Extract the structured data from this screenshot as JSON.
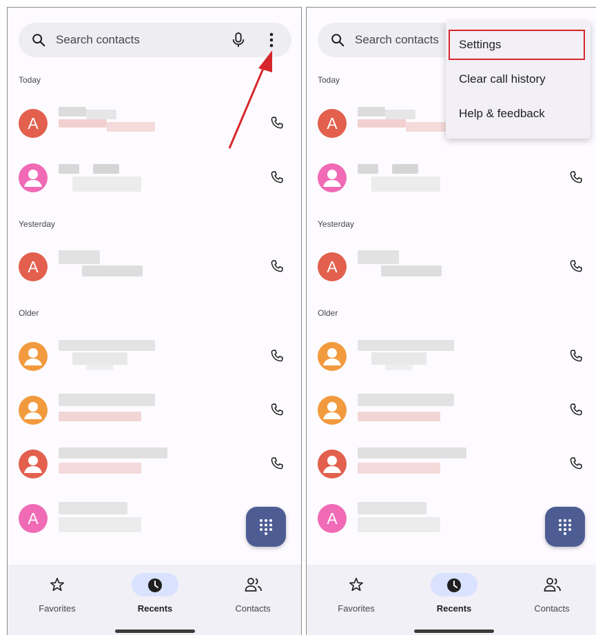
{
  "search": {
    "placeholder": "Search contacts"
  },
  "sections": {
    "today": "Today",
    "yesterday": "Yesterday",
    "older": "Older"
  },
  "contacts": [
    {
      "section": "today",
      "avatar_letter": "A",
      "avatar_type": "letter",
      "avatar_color": "#e2604d"
    },
    {
      "section": "today",
      "avatar_letter": "",
      "avatar_type": "person",
      "avatar_color": "#f06ab6"
    },
    {
      "section": "yesterday",
      "avatar_letter": "A",
      "avatar_type": "letter",
      "avatar_color": "#e2604d"
    },
    {
      "section": "older",
      "avatar_letter": "",
      "avatar_type": "person",
      "avatar_color": "#f29a3e"
    },
    {
      "section": "older",
      "avatar_letter": "",
      "avatar_type": "person",
      "avatar_color": "#f29a3e"
    },
    {
      "section": "older",
      "avatar_letter": "",
      "avatar_type": "person",
      "avatar_color": "#e2604d"
    },
    {
      "section": "older",
      "avatar_letter": "A",
      "avatar_type": "letter",
      "avatar_color": "#f06ab6"
    }
  ],
  "nav": {
    "favorites": "Favorites",
    "recents": "Recents",
    "contacts": "Contacts",
    "active": "recents"
  },
  "menu": {
    "items": [
      "Settings",
      "Clear call history",
      "Help & feedback"
    ],
    "highlighted": "Settings"
  },
  "icons": {
    "search": "search-icon",
    "mic": "mic-icon",
    "more": "more-vert-icon",
    "call": "phone-icon",
    "dialpad": "dialpad-icon",
    "favorites": "star-outline-icon",
    "recents": "clock-icon",
    "contacts": "people-icon"
  },
  "colors": {
    "fab": "#4d5d94",
    "nav_active_pill": "#d9e2ff",
    "annotation": "#d7262b",
    "search_bg": "#eeedf2"
  }
}
